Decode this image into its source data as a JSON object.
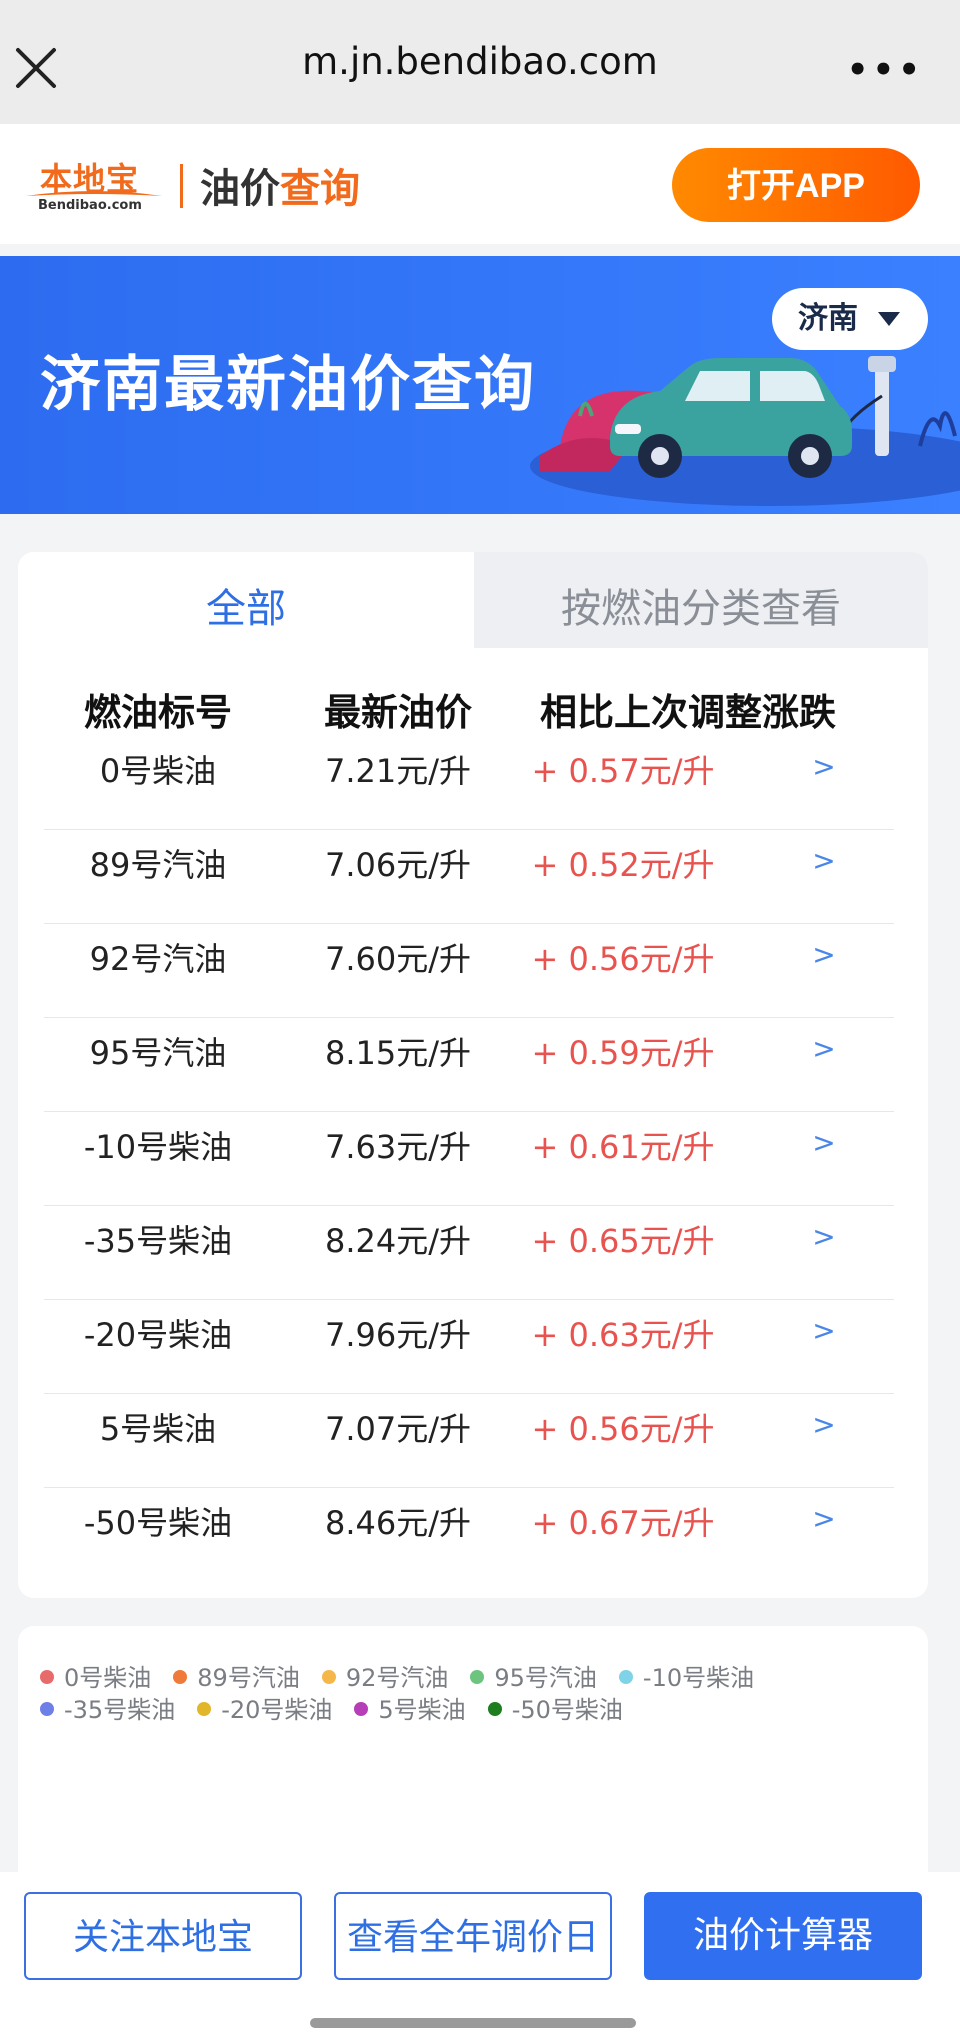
{
  "browser": {
    "url": "m.jn.bendibao.com"
  },
  "header": {
    "logo_cn": "本地宝",
    "logo_en": "Bendibao.com",
    "title_part1": "油价",
    "title_part2": "查询",
    "open_app_label": "打开APP"
  },
  "banner": {
    "title": "济南最新油价查询",
    "city": "济南"
  },
  "tabs": {
    "all": "全部",
    "by_category": "按燃油分类查看"
  },
  "table": {
    "headers": [
      "燃油标号",
      "最新油价",
      "相比上次调整涨跌"
    ],
    "rows": [
      {
        "fuel": "0号柴油",
        "price": "7.21元/升",
        "change": "+ 0.57元/升",
        "arrow": ">"
      },
      {
        "fuel": "89号汽油",
        "price": "7.06元/升",
        "change": "+ 0.52元/升",
        "arrow": ">"
      },
      {
        "fuel": "92号汽油",
        "price": "7.60元/升",
        "change": "+ 0.56元/升",
        "arrow": ">"
      },
      {
        "fuel": "95号汽油",
        "price": "8.15元/升",
        "change": "+ 0.59元/升",
        "arrow": ">"
      },
      {
        "fuel": "-10号柴油",
        "price": "7.63元/升",
        "change": "+ 0.61元/升",
        "arrow": ">"
      },
      {
        "fuel": "-35号柴油",
        "price": "8.24元/升",
        "change": "+ 0.65元/升",
        "arrow": ">"
      },
      {
        "fuel": "-20号柴油",
        "price": "7.96元/升",
        "change": "+ 0.63元/升",
        "arrow": ">"
      },
      {
        "fuel": "5号柴油",
        "price": "7.07元/升",
        "change": "+ 0.56元/升",
        "arrow": ">"
      },
      {
        "fuel": "-50号柴油",
        "price": "8.46元/升",
        "change": "+ 0.67元/升",
        "arrow": ">"
      }
    ]
  },
  "legend": [
    {
      "label": "0号柴油",
      "color": "#e86b6b"
    },
    {
      "label": "89号汽油",
      "color": "#f07a3a"
    },
    {
      "label": "92号汽油",
      "color": "#f5b74a"
    },
    {
      "label": "95号汽油",
      "color": "#6cc47f"
    },
    {
      "label": "-10号柴油",
      "color": "#7fd3e6"
    },
    {
      "label": "-35号柴油",
      "color": "#6f7fe8"
    },
    {
      "label": "-20号柴油",
      "color": "#e2b62a"
    },
    {
      "label": "5号柴油",
      "color": "#b63fb8"
    },
    {
      "label": "-50号柴油",
      "color": "#1e7d1e"
    }
  ],
  "bottom": {
    "follow_label": "关注本地宝",
    "calendar_label": "查看全年调价日",
    "calc_label": "油价计算器"
  }
}
